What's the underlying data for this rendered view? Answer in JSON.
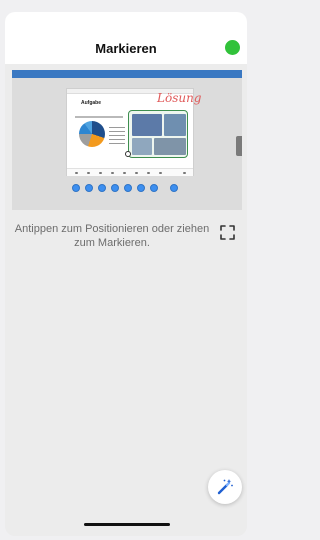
{
  "header": {
    "title": "Markieren",
    "status_color": "#31c23a"
  },
  "preview": {
    "slide_title": "Aufgabe",
    "handwritten_annotation": "Lösung",
    "pie_colors": [
      "#1f4e8c",
      "#f39a1e",
      "#9e9e9e",
      "#2e86d1",
      "#4fa3e0"
    ],
    "page_circle_count": 8,
    "accent_color": "#3a78c2"
  },
  "instruction": "Antippen zum Positionieren oder ziehen zum Markieren.",
  "icons": {
    "fullscreen": "expand-corners-icon",
    "magic_wand": "magic-wand-icon"
  }
}
